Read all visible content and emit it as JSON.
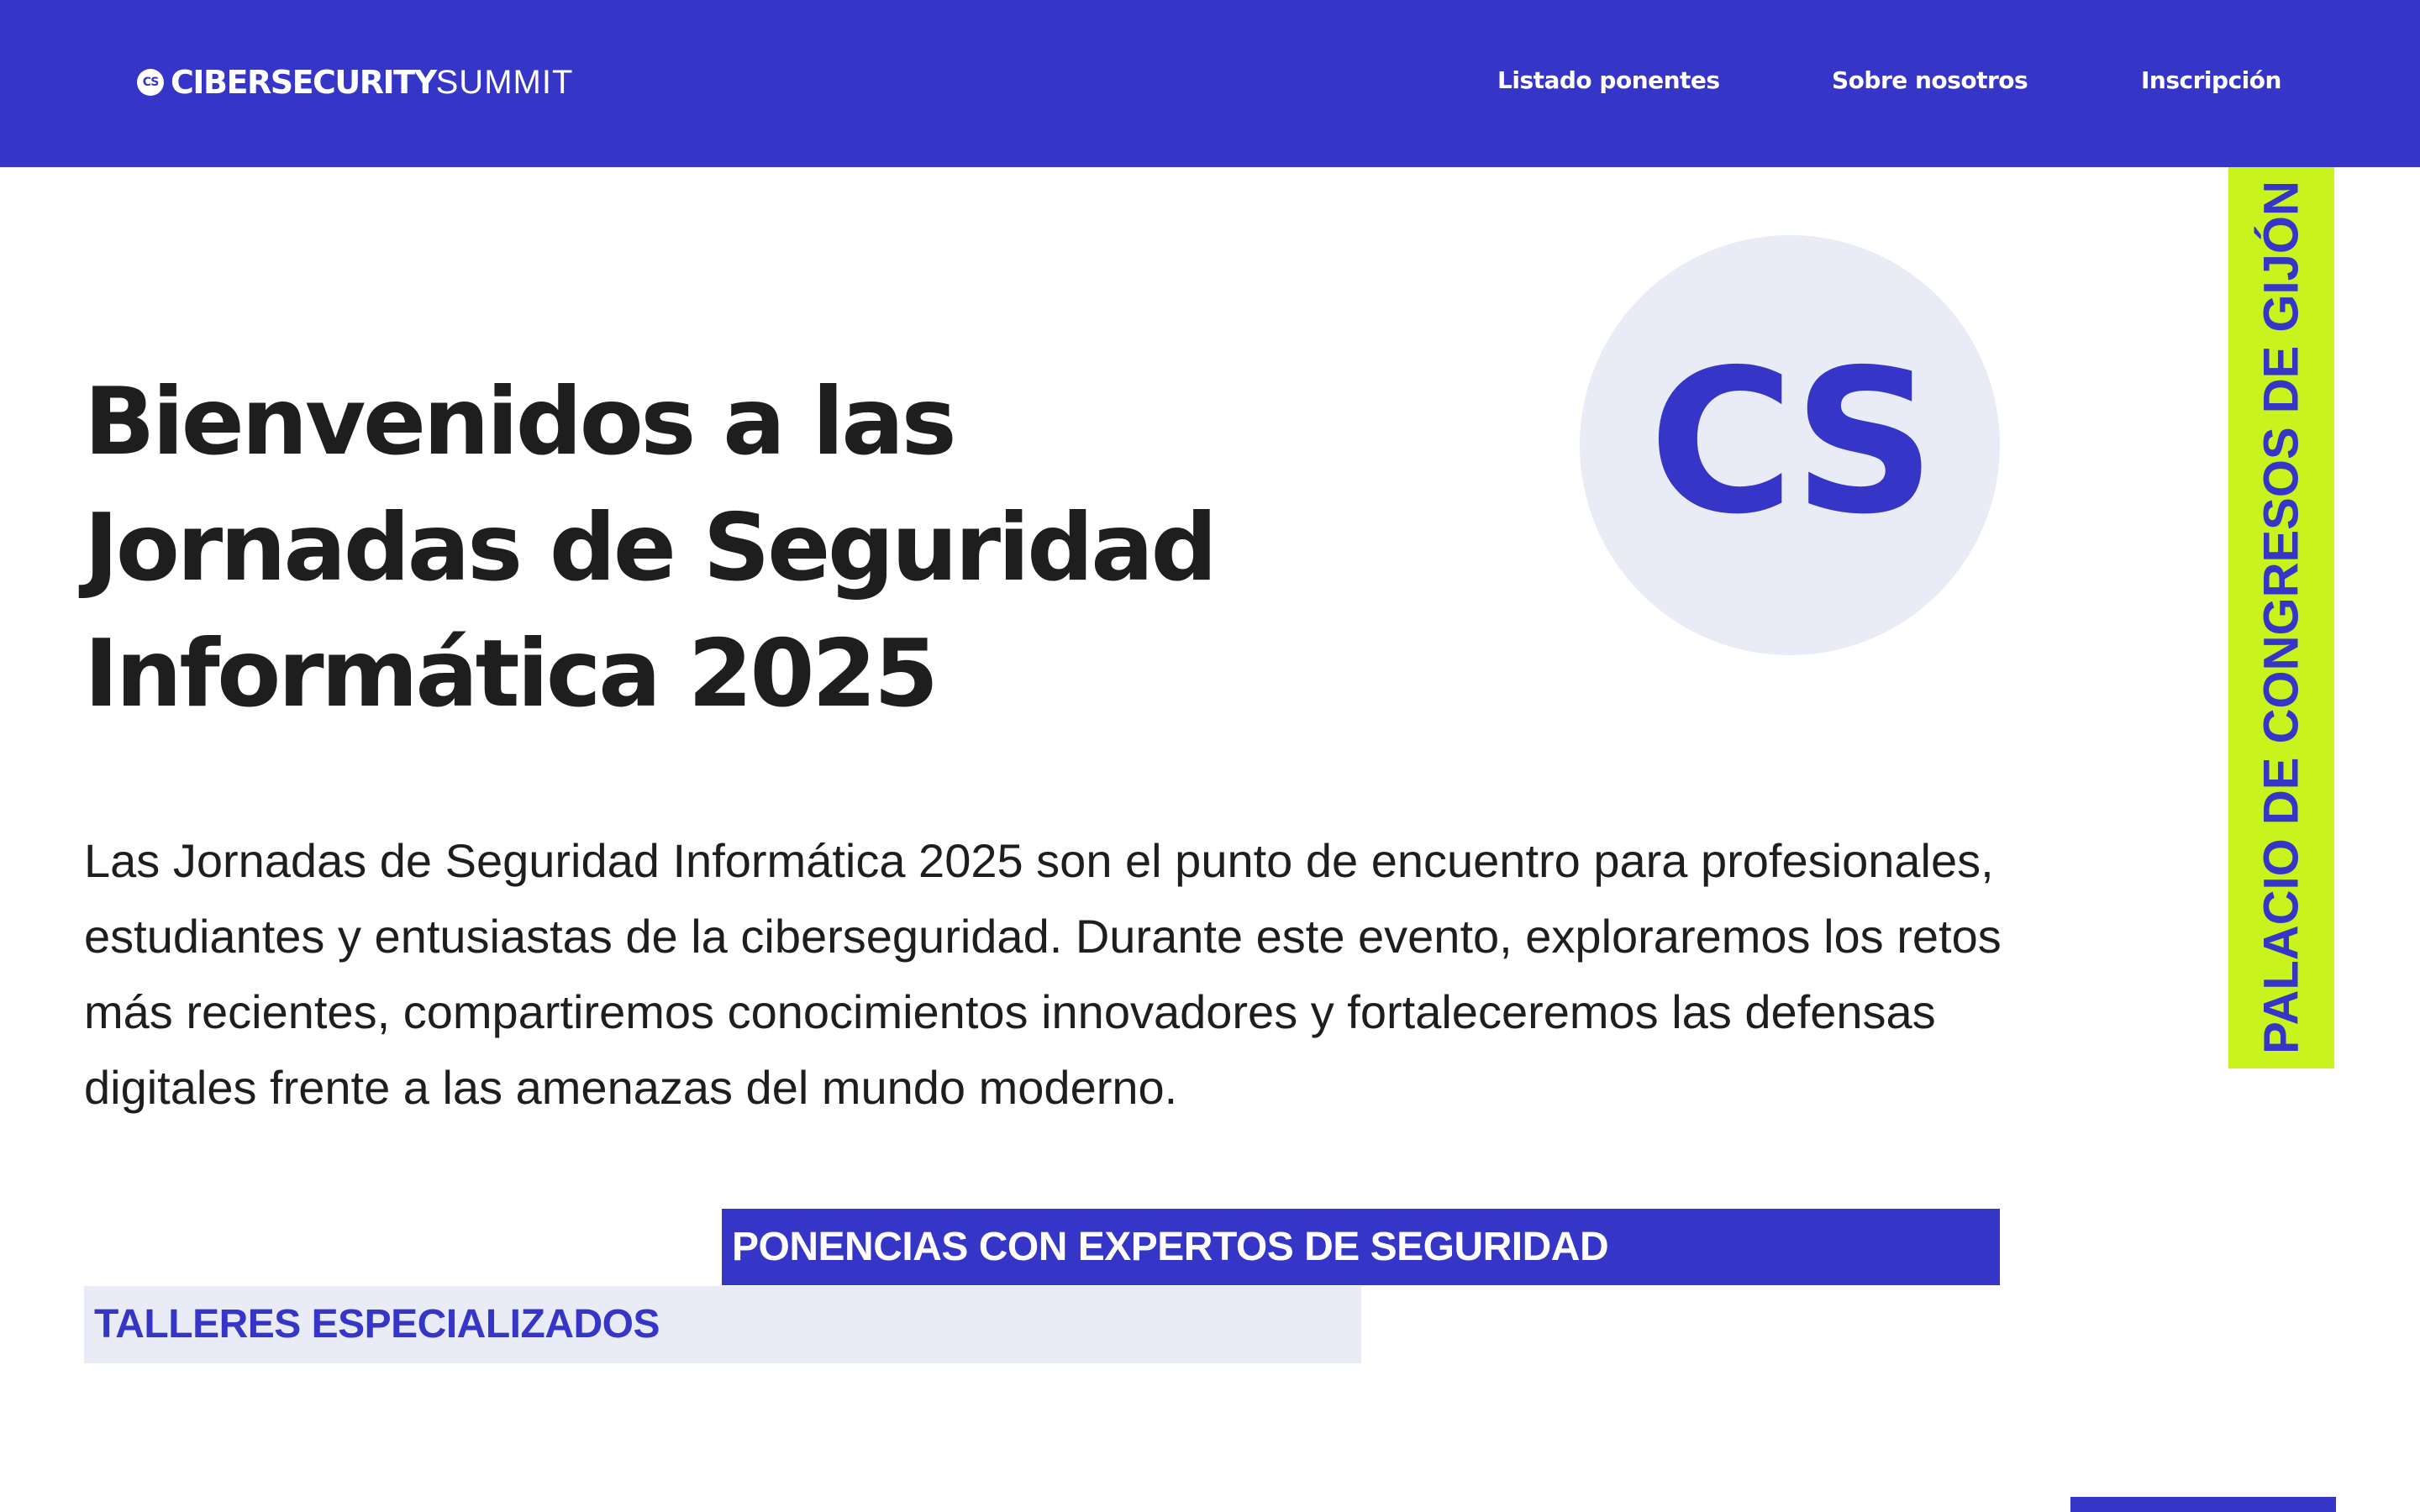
{
  "colors": {
    "primary": "#3535c7",
    "accent": "#c8f31d",
    "light": "#e9ebf6",
    "text": "#1e1e1e",
    "background": "#ffffff"
  },
  "header": {
    "brand": {
      "badge": "CS",
      "strong": "CIBERSECURITY",
      "light": "SUMMIT"
    },
    "nav": [
      {
        "label": "Listado ponentes"
      },
      {
        "label": "Sobre nosotros"
      },
      {
        "label": "Inscripción"
      }
    ]
  },
  "venue": {
    "label": "PALACIO DE CONGRESOS DE GIJÓN"
  },
  "logo": {
    "text": "CS"
  },
  "hero": {
    "title_lines": [
      "Bienvenidos a las",
      "Jornadas de Seguridad",
      "Informática 2025"
    ],
    "intro": "Las Jornadas de Seguridad Informática 2025 son el punto de encuentro para profesionales, estudiantes y entusiastas de la ciberseguridad. Durante este evento, exploraremos los retos más recientes, compartiremos conocimientos innovadores y fortaleceremos las defensas digitales frente a las amenazas del mundo moderno."
  },
  "features": [
    {
      "label": "PONENCIAS CON EXPERTOS DE SEGURIDAD"
    },
    {
      "label": "TALLERES ESPECIALIZADOS"
    }
  ]
}
